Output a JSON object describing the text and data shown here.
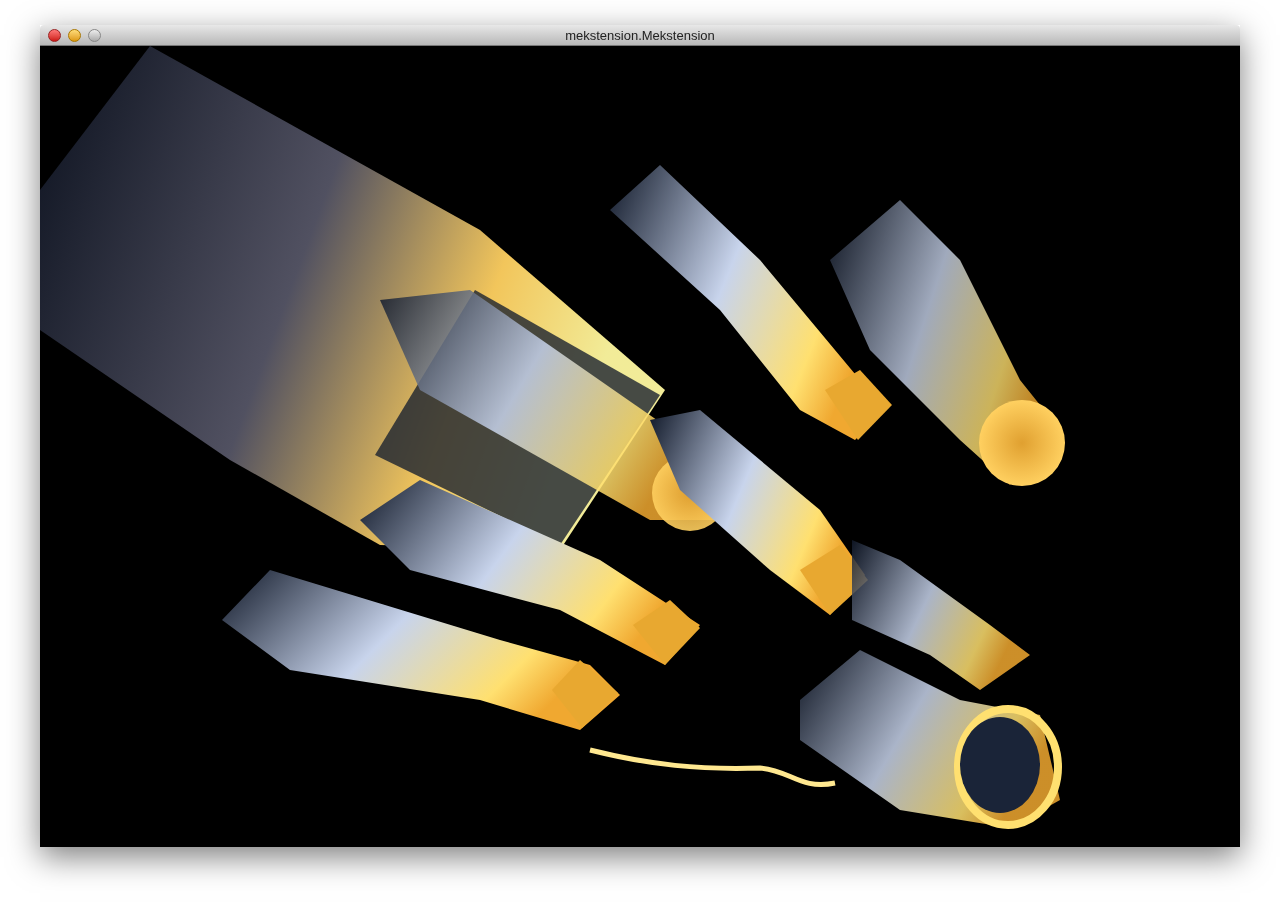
{
  "window": {
    "title": "mekstension.Mekstension"
  }
}
